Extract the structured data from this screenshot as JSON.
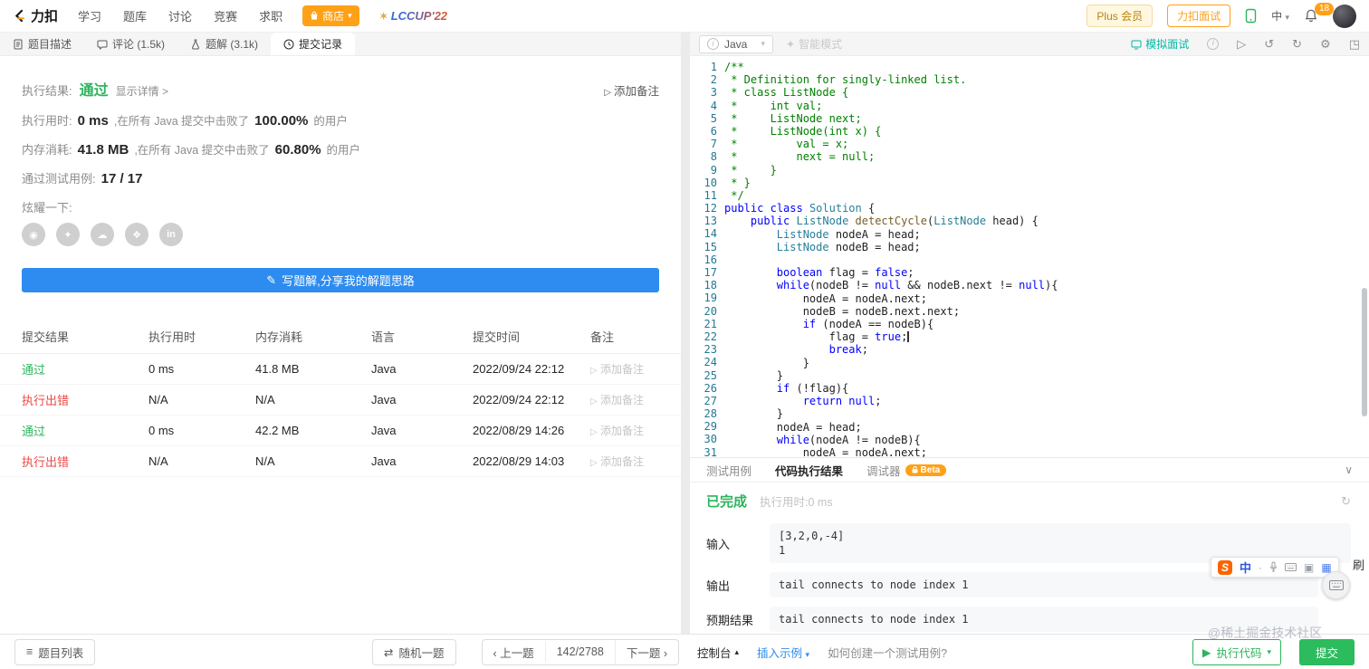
{
  "navbar": {
    "logo_text": "力扣",
    "items": [
      "学习",
      "题库",
      "讨论",
      "竞赛",
      "求职"
    ],
    "store_label": "商店",
    "lccup_label": "LCCUP'22",
    "plus_label": "Plus 会员",
    "interview_label": "力扣面试",
    "lang_label": "中",
    "notification_count": "18"
  },
  "tabs": {
    "description": "题目描述",
    "comments": "评论 (1.5k)",
    "solutions": "题解 (3.1k)",
    "submissions": "提交记录"
  },
  "result": {
    "label": "执行结果:",
    "status": "通过",
    "details": "显示详情 >",
    "add_note": "添加备注",
    "runtime_label": "执行用时:",
    "runtime": "0 ms",
    "beat_mid": ",在所有 Java 提交中击败了",
    "runtime_pct": "100.00%",
    "users_suffix": "的用户",
    "memory_label": "内存消耗:",
    "memory": "41.8 MB",
    "memory_pct": "60.80%",
    "cases_label": "通过测试用例:",
    "cases": "17 / 17",
    "brag_label": "炫耀一下:",
    "linkedin_label": "in",
    "write_solution": "写题解,分享我的解题思路"
  },
  "submissions": {
    "headers": [
      "提交结果",
      "执行用时",
      "内存消耗",
      "语言",
      "提交时间",
      "备注"
    ],
    "add_note": "添加备注",
    "rows": [
      {
        "result": "通过",
        "status": "pass",
        "runtime": "0 ms",
        "memory": "41.8 MB",
        "lang": "Java",
        "time": "2022/09/24 22:12"
      },
      {
        "result": "执行出错",
        "status": "error",
        "runtime": "N/A",
        "memory": "N/A",
        "lang": "Java",
        "time": "2022/09/24 22:12"
      },
      {
        "result": "通过",
        "status": "pass",
        "runtime": "0 ms",
        "memory": "42.2 MB",
        "lang": "Java",
        "time": "2022/08/29 14:26"
      },
      {
        "result": "执行出错",
        "status": "error",
        "runtime": "N/A",
        "memory": "N/A",
        "lang": "Java",
        "time": "2022/08/29 14:03"
      }
    ]
  },
  "editor": {
    "language": "Java",
    "smart_mode": "智能模式",
    "mock_interview": "模拟面试",
    "lines": [
      [
        [
          "c",
          "/**"
        ]
      ],
      [
        [
          "c",
          " * Definition for singly-linked list."
        ]
      ],
      [
        [
          "c",
          " * class ListNode {"
        ]
      ],
      [
        [
          "c",
          " *     int val;"
        ]
      ],
      [
        [
          "c",
          " *     ListNode next;"
        ]
      ],
      [
        [
          "c",
          " *     ListNode(int x) {"
        ]
      ],
      [
        [
          "c",
          " *         val = x;"
        ]
      ],
      [
        [
          "c",
          " *         next = null;"
        ]
      ],
      [
        [
          "c",
          " *     }"
        ]
      ],
      [
        [
          "c",
          " * }"
        ]
      ],
      [
        [
          "c",
          " */"
        ]
      ],
      [
        [
          "k",
          "public"
        ],
        [
          "p",
          " "
        ],
        [
          "k",
          "class"
        ],
        [
          "p",
          " "
        ],
        [
          "t",
          "Solution"
        ],
        [
          "p",
          " {"
        ]
      ],
      [
        [
          "p",
          "    "
        ],
        [
          "k",
          "public"
        ],
        [
          "p",
          " "
        ],
        [
          "t",
          "ListNode"
        ],
        [
          "p",
          " "
        ],
        [
          "f",
          "detectCycle"
        ],
        [
          "p",
          "("
        ],
        [
          "t",
          "ListNode"
        ],
        [
          "p",
          " head) {"
        ]
      ],
      [
        [
          "p",
          "        "
        ],
        [
          "t",
          "ListNode"
        ],
        [
          "p",
          " nodeA = head;"
        ]
      ],
      [
        [
          "p",
          "        "
        ],
        [
          "t",
          "ListNode"
        ],
        [
          "p",
          " nodeB = head;"
        ]
      ],
      [],
      [
        [
          "p",
          "        "
        ],
        [
          "k",
          "boolean"
        ],
        [
          "p",
          " flag = "
        ],
        [
          "k",
          "false"
        ],
        [
          "p",
          ";"
        ]
      ],
      [
        [
          "p",
          "        "
        ],
        [
          "k",
          "while"
        ],
        [
          "p",
          "(nodeB != "
        ],
        [
          "k",
          "null"
        ],
        [
          "p",
          " && nodeB.next != "
        ],
        [
          "k",
          "null"
        ],
        [
          "p",
          "){"
        ]
      ],
      [
        [
          "p",
          "            nodeA = nodeA.next;"
        ]
      ],
      [
        [
          "p",
          "            nodeB = nodeB.next.next;"
        ]
      ],
      [
        [
          "p",
          "            "
        ],
        [
          "k",
          "if"
        ],
        [
          "p",
          " (nodeA == nodeB){"
        ]
      ],
      [
        [
          "p",
          "                flag = "
        ],
        [
          "k",
          "true"
        ],
        [
          "p",
          ";"
        ],
        [
          "cur",
          ""
        ]
      ],
      [
        [
          "p",
          "                "
        ],
        [
          "k",
          "break"
        ],
        [
          "p",
          ";"
        ]
      ],
      [
        [
          "p",
          "            }"
        ]
      ],
      [
        [
          "p",
          "        }"
        ]
      ],
      [
        [
          "p",
          "        "
        ],
        [
          "k",
          "if"
        ],
        [
          "p",
          " (!flag){"
        ]
      ],
      [
        [
          "p",
          "            "
        ],
        [
          "k",
          "return"
        ],
        [
          "p",
          " "
        ],
        [
          "k",
          "null"
        ],
        [
          "p",
          ";"
        ]
      ],
      [
        [
          "p",
          "        }"
        ]
      ],
      [
        [
          "p",
          "        nodeA = head;"
        ]
      ],
      [
        [
          "p",
          "        "
        ],
        [
          "k",
          "while"
        ],
        [
          "p",
          "(nodeA != nodeB){"
        ]
      ],
      [
        [
          "p",
          "            nodeA = nodeA.next;"
        ]
      ]
    ]
  },
  "console": {
    "tab_testcase": "测试用例",
    "tab_result": "代码执行结果",
    "tab_debugger": "调试器",
    "beta": "Beta",
    "status": "已完成",
    "runtime_text": "执行用时:0 ms",
    "input_label": "输入",
    "input_line1": "[3,2,0,-4]",
    "input_line2": "1",
    "output_label": "输出",
    "output_value": "tail connects to node index 1",
    "expected_label": "预期结果",
    "expected_value": "tail connects to node index 1"
  },
  "bottombar": {
    "problem_list": "题目列表",
    "random": "随机一题",
    "prev": "上一题",
    "counter": "142/2788",
    "next": "下一题",
    "console_toggle": "控制台",
    "insert_example": "插入示例",
    "howto": "如何创建一个测试用例?",
    "run": "执行代码",
    "submit": "提交"
  },
  "ime": {
    "zhong": "中",
    "shua": "刷"
  },
  "watermark": "@稀土掘金技术社区",
  "colors": {
    "green": "#2db55d",
    "red": "#ef4743",
    "blue": "#2e8cf0",
    "orange": "#ffa116",
    "teal": "#00b8a3"
  }
}
